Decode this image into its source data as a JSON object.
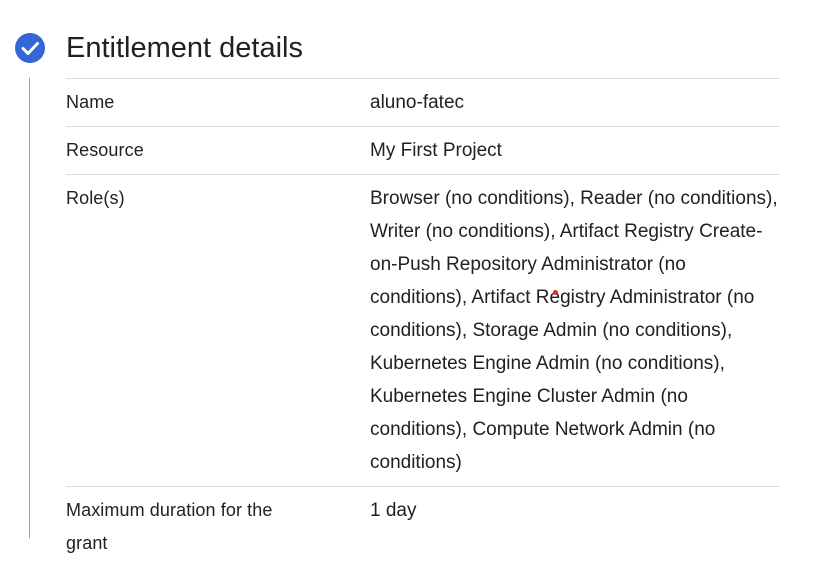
{
  "header": {
    "title": "Entitlement details",
    "status_icon": "check-circle-icon",
    "accent_color": "#3367d6"
  },
  "details": {
    "rows": [
      {
        "label": "Name",
        "value": "aluno-fatec"
      },
      {
        "label": "Resource",
        "value": "My First Project"
      },
      {
        "label": "Role(s)",
        "value": "Browser (no conditions), Reader (no conditions), Writer (no conditions), Artifact Registry Create-on-Push Repository Administrator (no conditions), Artifact Registry Administrator (no conditions), Storage Admin (no conditions), Kubernetes Engine Admin (no conditions), Kubernetes Engine Cluster Admin (no conditions), Compute Network Admin (no conditions)"
      },
      {
        "label": "Maximum duration for the grant",
        "value": "1 day"
      }
    ]
  }
}
